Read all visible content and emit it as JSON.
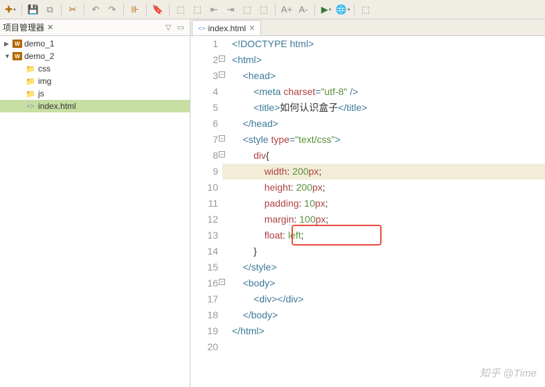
{
  "panel": {
    "title": "项目管理器"
  },
  "tree": {
    "demo1": "demo_1",
    "demo2": "demo_2",
    "css": "css",
    "img": "img",
    "js": "js",
    "index": "index.html"
  },
  "tab": {
    "filename": "index.html"
  },
  "code": {
    "l1": "<!DOCTYPE html>",
    "l2a": "<",
    "l2b": "html",
    "l2c": ">",
    "l3a": "<",
    "l3b": "head",
    "l3c": ">",
    "l4a": "<",
    "l4b": "meta ",
    "l4c": "charset",
    "l4d": "=",
    "l4e": "\"utf-8\"",
    "l4f": " />",
    "l5a": "<",
    "l5b": "title",
    "l5c": ">",
    "l5d": "如何认识盒子",
    "l5e": "</",
    "l5f": "title",
    "l5g": ">",
    "l6a": "</",
    "l6b": "head",
    "l6c": ">",
    "l7a": "<",
    "l7b": "style ",
    "l7c": "type",
    "l7d": "=",
    "l7e": "\"text/css\"",
    "l7f": ">",
    "l8a": "div",
    "l8b": "{",
    "l9a": "width",
    "l9b": ": ",
    "l9c": "200",
    "l9d": "px",
    "l9e": ";",
    "l10a": "height",
    "l10b": ": ",
    "l10c": "200",
    "l10d": "px",
    "l10e": ";",
    "l11a": "padding",
    "l11b": ": ",
    "l11c": "10",
    "l11d": "px",
    "l11e": ";",
    "l12a": "margin",
    "l12b": ": ",
    "l12c": "100",
    "l12d": "px",
    "l12e": ";",
    "l13a": "float",
    "l13b": ": ",
    "l13c": "left",
    "l13d": ";",
    "l14": "}",
    "l15a": "</",
    "l15b": "style",
    "l15c": ">",
    "l16a": "<",
    "l16b": "body",
    "l16c": ">",
    "l17a": "<",
    "l17b": "div",
    "l17c": "></",
    "l17d": "div",
    "l17e": ">",
    "l18a": "</",
    "l18b": "body",
    "l18c": ">",
    "l19a": "</",
    "l19b": "html",
    "l19c": ">"
  },
  "lines": {
    "n1": "1",
    "n2": "2",
    "n3": "3",
    "n4": "4",
    "n5": "5",
    "n6": "6",
    "n7": "7",
    "n8": "8",
    "n9": "9",
    "n10": "10",
    "n11": "11",
    "n12": "12",
    "n13": "13",
    "n14": "14",
    "n15": "15",
    "n16": "16",
    "n17": "17",
    "n18": "18",
    "n19": "19",
    "n20": "20"
  },
  "watermark": "知乎 @Time"
}
